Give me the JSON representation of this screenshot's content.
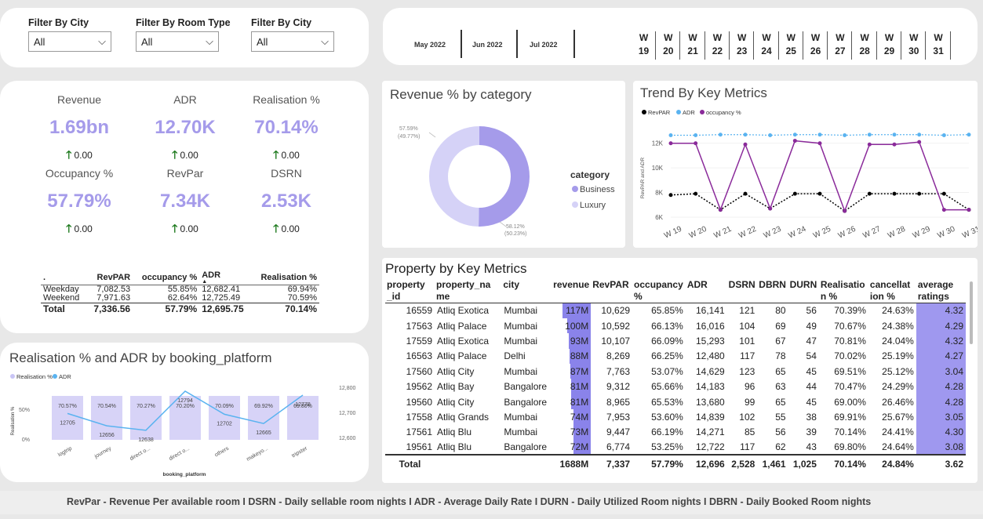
{
  "filters": [
    {
      "label": "Filter By City",
      "value": "All"
    },
    {
      "label": "Filter By Room Type",
      "value": "All"
    },
    {
      "label": "Filter By City",
      "value": "All"
    }
  ],
  "months": [
    "May 2022",
    "Jun 2022",
    "Jul 2022"
  ],
  "weeks": [
    {
      "w": "W",
      "n": "19"
    },
    {
      "w": "W",
      "n": "20"
    },
    {
      "w": "W",
      "n": "21"
    },
    {
      "w": "W",
      "n": "22"
    },
    {
      "w": "W",
      "n": "23"
    },
    {
      "w": "W",
      "n": "24"
    },
    {
      "w": "W",
      "n": "25"
    },
    {
      "w": "W",
      "n": "26"
    },
    {
      "w": "W",
      "n": "27"
    },
    {
      "w": "W",
      "n": "28"
    },
    {
      "w": "W",
      "n": "29"
    },
    {
      "w": "W",
      "n": "30"
    },
    {
      "w": "W",
      "n": "31"
    }
  ],
  "kpis": [
    {
      "title": "Revenue",
      "value": "1.69bn",
      "delta": "0.00"
    },
    {
      "title": "ADR",
      "value": "12.70K",
      "delta": "0.00"
    },
    {
      "title": "Realisation %",
      "value": "70.14%",
      "delta": "0.00"
    },
    {
      "title": "Occupancy %",
      "value": "57.79%",
      "delta": "0.00"
    },
    {
      "title": "RevPar",
      "value": "7.34K",
      "delta": "0.00"
    },
    {
      "title": "DSRN",
      "value": "2.53K",
      "delta": "0.00"
    }
  ],
  "summary": {
    "headers": [
      ".",
      "RevPAR",
      "occupancy %",
      "ADR",
      "Realisation %"
    ],
    "rows": [
      [
        "Weekday",
        "7,082.53",
        "55.85%",
        "12,682.41",
        "69.94%"
      ],
      [
        "Weekend",
        "7,971.63",
        "62.64%",
        "12,725.49",
        "70.59%"
      ],
      [
        "Total",
        "7,336.56",
        "57.79%",
        "12,695.75",
        "70.14%"
      ]
    ]
  },
  "realisation_chart": {
    "title": "Realisation % and ADR by booking_platform",
    "legend": [
      "Realisation %",
      "ADR"
    ],
    "xlabel": "booking_platform",
    "ylabel": "Realisation %",
    "left_ticks": [
      "50%",
      "0%"
    ],
    "right_ticks": [
      "12,800",
      "12,700",
      "12,600"
    ],
    "platforms": [
      "logtrip",
      "journey",
      "direct o...",
      "direct o...",
      "others",
      "makeyo...",
      "tripster"
    ],
    "real_labels": [
      "70.57%",
      "70.54%",
      "70.27%",
      "70.20%",
      "70.09%",
      "69.92%",
      "69.80%"
    ],
    "adr_labels": [
      "12705",
      "12656",
      "12638",
      "12794",
      "12702",
      "12665",
      "12778"
    ]
  },
  "donut": {
    "title": "Revenue % by category",
    "legend_title": "category",
    "categories": [
      "Business",
      "Luxury"
    ],
    "label_luxury_1": "57.59%",
    "label_luxury_2": "(49.77%)",
    "label_business_1": "58.12%",
    "label_business_2": "(50.23%)",
    "colors": [
      "#a59bea",
      "#d5d2f7"
    ]
  },
  "trend": {
    "title": "Trend By Key Metrics",
    "legend": [
      "RevPAR",
      "ADR",
      "occupancy %"
    ],
    "ylabel": "RevPAR and ADR",
    "yticks": [
      "12K",
      "10K",
      "8K",
      "6K"
    ],
    "xticks": [
      "W 19",
      "W 20",
      "W 21",
      "W 22",
      "W 23",
      "W 24",
      "W 25",
      "W 26",
      "W 27",
      "W 28",
      "W 29",
      "W 30",
      "W 31"
    ]
  },
  "chart_data": {
    "type": "line",
    "title": "Trend By Key Metrics",
    "x": [
      "W 19",
      "W 20",
      "W 21",
      "W 22",
      "W 23",
      "W 24",
      "W 25",
      "W 26",
      "W 27",
      "W 28",
      "W 29",
      "W 30",
      "W 31"
    ],
    "ylabel": "RevPAR and ADR",
    "ylim": [
      6000,
      13000
    ],
    "series": [
      {
        "name": "RevPAR",
        "values": [
          7800,
          7900,
          6600,
          7900,
          6700,
          7900,
          7900,
          6500,
          7900,
          7900,
          7900,
          7900,
          6600
        ],
        "color": "#000000"
      },
      {
        "name": "ADR",
        "values": [
          12650,
          12650,
          12700,
          12700,
          12650,
          12700,
          12700,
          12650,
          12700,
          12700,
          12700,
          12650,
          12700
        ],
        "color": "#5ab3f0"
      },
      {
        "name": "occupancy %",
        "values": [
          12000,
          12000,
          6600,
          11900,
          6700,
          12200,
          12000,
          6500,
          11900,
          11900,
          12100,
          6600,
          6600
        ],
        "color": "#8a2a9a"
      }
    ]
  },
  "property": {
    "title": "Property by Key Metrics",
    "headers": [
      "property\n_id",
      "property_na\nme",
      "city",
      "revenue",
      "RevPAR",
      "occupancy\n%",
      "ADR",
      "DSRN",
      "DBRN",
      "DURN",
      "Realisatio\nn %",
      "cancellat\nion %",
      "average\nratings"
    ],
    "rows": [
      [
        "16559",
        "Atliq Exotica",
        "Mumbai",
        "117M",
        "10,629",
        "65.85%",
        "16,141",
        "121",
        "80",
        "56",
        "70.39%",
        "24.63%",
        "4.32"
      ],
      [
        "17563",
        "Atliq Palace",
        "Mumbai",
        "100M",
        "10,592",
        "66.13%",
        "16,016",
        "104",
        "69",
        "49",
        "70.67%",
        "24.38%",
        "4.29"
      ],
      [
        "17559",
        "Atliq Exotica",
        "Mumbai",
        "93M",
        "10,107",
        "66.09%",
        "15,293",
        "101",
        "67",
        "47",
        "70.81%",
        "24.04%",
        "4.32"
      ],
      [
        "16563",
        "Atliq Palace",
        "Delhi",
        "88M",
        "8,269",
        "66.25%",
        "12,480",
        "117",
        "78",
        "54",
        "70.02%",
        "25.19%",
        "4.27"
      ],
      [
        "17560",
        "Atliq City",
        "Mumbai",
        "87M",
        "7,763",
        "53.07%",
        "14,629",
        "123",
        "65",
        "45",
        "69.51%",
        "25.12%",
        "3.04"
      ],
      [
        "19562",
        "Atliq Bay",
        "Bangalore",
        "81M",
        "9,312",
        "65.66%",
        "14,183",
        "96",
        "63",
        "44",
        "70.47%",
        "24.29%",
        "4.28"
      ],
      [
        "19560",
        "Atliq City",
        "Bangalore",
        "81M",
        "8,965",
        "65.53%",
        "13,680",
        "99",
        "65",
        "45",
        "69.00%",
        "26.46%",
        "4.28"
      ],
      [
        "17558",
        "Atliq Grands",
        "Mumbai",
        "74M",
        "7,953",
        "53.60%",
        "14,839",
        "102",
        "55",
        "38",
        "69.91%",
        "25.67%",
        "3.05"
      ],
      [
        "17561",
        "Atliq Blu",
        "Mumbai",
        "73M",
        "9,447",
        "66.19%",
        "14,271",
        "85",
        "56",
        "39",
        "70.14%",
        "24.41%",
        "4.30"
      ],
      [
        "19561",
        "Atliq Blu",
        "Bangalore",
        "72M",
        "6,774",
        "53.25%",
        "12,722",
        "117",
        "62",
        "43",
        "69.80%",
        "24.64%",
        "3.08"
      ]
    ],
    "total": [
      "Total",
      "",
      "",
      "1688M",
      "7,337",
      "57.79%",
      "12,696",
      "2,528",
      "1,461",
      "1,025",
      "70.14%",
      "24.84%",
      "3.62"
    ],
    "revenue_fill": [
      1.0,
      0.85,
      0.79,
      0.75,
      0.74,
      0.69,
      0.69,
      0.63,
      0.62,
      0.61
    ]
  },
  "footer": "RevPar - Revenue Per available room I DSRN - Daily sellable room nights I ADR - Average Daily Rate I DURN - Daily Utilized Room nights I DBRN - Daily Booked Room nights"
}
